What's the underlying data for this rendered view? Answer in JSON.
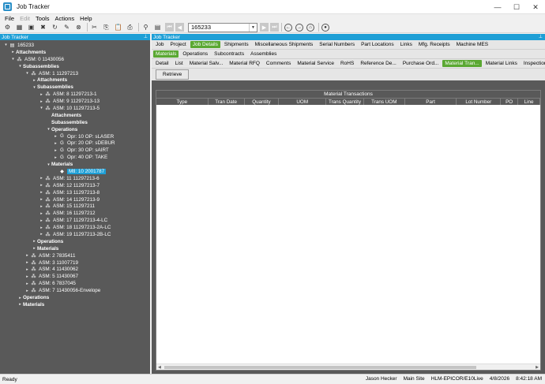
{
  "window": {
    "title": "Job Tracker"
  },
  "menu": [
    {
      "label": "File",
      "disabled": false
    },
    {
      "label": "Edit",
      "disabled": true
    },
    {
      "label": "Tools",
      "disabled": false
    },
    {
      "label": "Actions",
      "disabled": false
    },
    {
      "label": "Help",
      "disabled": false
    }
  ],
  "toolbar": {
    "job_value": "165233"
  },
  "left_panel": {
    "title": "Job Tracker"
  },
  "tree": [
    {
      "label": "165233",
      "level": 0,
      "toggle": "▾",
      "icon": "job-icon",
      "bold": false
    },
    {
      "label": "Attachments",
      "level": 1,
      "toggle": "▸",
      "icon": "",
      "bold": true
    },
    {
      "label": "ASM: 0 11430056",
      "level": 1,
      "toggle": "▾",
      "icon": "assembly-icon",
      "bold": false
    },
    {
      "label": "Subassemblies",
      "level": 2,
      "toggle": "▾",
      "icon": "",
      "bold": true
    },
    {
      "label": "ASM: 1 11297213",
      "level": 3,
      "toggle": "▾",
      "icon": "assembly-icon",
      "bold": false
    },
    {
      "label": "Attachments",
      "level": 4,
      "toggle": "▸",
      "icon": "",
      "bold": true
    },
    {
      "label": "Subassemblies",
      "level": 4,
      "toggle": "▾",
      "icon": "",
      "bold": true
    },
    {
      "label": "ASM: 8 11297213-1",
      "level": 5,
      "toggle": "▸",
      "icon": "assembly-icon",
      "bold": false
    },
    {
      "label": "ASM: 9 11297213-13",
      "level": 5,
      "toggle": "▸",
      "icon": "assembly-icon",
      "bold": false
    },
    {
      "label": "ASM: 10 11297213-5",
      "level": 5,
      "toggle": "▾",
      "icon": "assembly-icon",
      "bold": false
    },
    {
      "label": "Attachments",
      "level": 6,
      "toggle": "",
      "icon": "",
      "bold": true
    },
    {
      "label": "Subassemblies",
      "level": 6,
      "toggle": "",
      "icon": "",
      "bold": true
    },
    {
      "label": "Operations",
      "level": 6,
      "toggle": "▾",
      "icon": "",
      "bold": true
    },
    {
      "label": "Opr: 10 OP: sLASER",
      "level": 7,
      "toggle": "▸",
      "icon": "operation-icon",
      "bold": false
    },
    {
      "label": "Opr: 20 OP: sDEBUR",
      "level": 7,
      "toggle": "▸",
      "icon": "operation-icon",
      "bold": false
    },
    {
      "label": "Opr: 30 OP: sAIRT",
      "level": 7,
      "toggle": "▸",
      "icon": "operation-icon",
      "bold": false
    },
    {
      "label": "Opr: 40 OP: TAKE",
      "level": 7,
      "toggle": "▸",
      "icon": "operation-icon",
      "bold": false
    },
    {
      "label": "Materials",
      "level": 6,
      "toggle": "▾",
      "icon": "",
      "bold": true
    },
    {
      "label": "Mtl: 10 2001787",
      "level": 7,
      "toggle": "",
      "icon": "material-icon",
      "bold": false,
      "selected": true
    },
    {
      "label": "ASM: 11 11297213-6",
      "level": 5,
      "toggle": "▸",
      "icon": "assembly-icon",
      "bold": false
    },
    {
      "label": "ASM: 12 11297213-7",
      "level": 5,
      "toggle": "▸",
      "icon": "assembly-icon",
      "bold": false
    },
    {
      "label": "ASM: 13 11297213-8",
      "level": 5,
      "toggle": "▸",
      "icon": "assembly-icon",
      "bold": false
    },
    {
      "label": "ASM: 14 11297213-9",
      "level": 5,
      "toggle": "▸",
      "icon": "assembly-icon",
      "bold": false
    },
    {
      "label": "ASM: 15 11297211",
      "level": 5,
      "toggle": "▸",
      "icon": "assembly-icon",
      "bold": false
    },
    {
      "label": "ASM: 16 11297212",
      "level": 5,
      "toggle": "▸",
      "icon": "assembly-icon",
      "bold": false
    },
    {
      "label": "ASM: 17 11297213-4-LC",
      "level": 5,
      "toggle": "▸",
      "icon": "assembly-icon",
      "bold": false
    },
    {
      "label": "ASM: 18 11297213-2A-LC",
      "level": 5,
      "toggle": "▸",
      "icon": "assembly-icon",
      "bold": false
    },
    {
      "label": "ASM: 19 11297213-2B-LC",
      "level": 5,
      "toggle": "▸",
      "icon": "assembly-icon",
      "bold": false
    },
    {
      "label": "Operations",
      "level": 4,
      "toggle": "▸",
      "icon": "",
      "bold": true
    },
    {
      "label": "Materials",
      "level": 4,
      "toggle": "▸",
      "icon": "",
      "bold": true
    },
    {
      "label": "ASM: 2 7835411",
      "level": 3,
      "toggle": "▸",
      "icon": "assembly-icon",
      "bold": false
    },
    {
      "label": "ASM: 3 11007719",
      "level": 3,
      "toggle": "▸",
      "icon": "assembly-icon",
      "bold": false
    },
    {
      "label": "ASM: 4 11430062",
      "level": 3,
      "toggle": "▸",
      "icon": "assembly-icon",
      "bold": false
    },
    {
      "label": "ASM: 5 11430067",
      "level": 3,
      "toggle": "▸",
      "icon": "assembly-icon",
      "bold": false
    },
    {
      "label": "ASM: 6 7837045",
      "level": 3,
      "toggle": "▸",
      "icon": "assembly-icon",
      "bold": false
    },
    {
      "label": "ASM: 7 11430056-Envelope",
      "level": 3,
      "toggle": "▸",
      "icon": "assembly-icon",
      "bold": false
    },
    {
      "label": "Operations",
      "level": 2,
      "toggle": "▸",
      "icon": "",
      "bold": true
    },
    {
      "label": "Materials",
      "level": 2,
      "toggle": "▸",
      "icon": "",
      "bold": true
    }
  ],
  "right_panel": {
    "title": "Job Tracker"
  },
  "tabs_level1": [
    "Job",
    "Project",
    "Job Details",
    "Shipments",
    "Miscellaneous Shipments",
    "Serial Numbers",
    "Part Locations",
    "Links",
    "Mfg. Receipts",
    "Machine MES"
  ],
  "tabs_level1_active": 2,
  "tabs_level2": [
    "Materials",
    "Operations",
    "Subcontracts",
    "Assemblies"
  ],
  "tabs_level2_active": 0,
  "tabs_level3": [
    "Detail",
    "List",
    "Material Salv...",
    "Material RFQ",
    "Comments",
    "Material Service",
    "RoHS",
    "Reference De...",
    "Purchase Ord...",
    "Material Tran...",
    "Material Links",
    "Inspection"
  ],
  "tabs_level3_active": 9,
  "retrieve_label": "Retrieve",
  "grid": {
    "caption": "Material Transactions",
    "columns": [
      "Type",
      "Tran Date",
      "Quantity",
      "UOM",
      "Trans Quantity",
      "Trans UOM",
      "Part",
      "Lot Number",
      "PO",
      "Line"
    ]
  },
  "status": {
    "left": "Ready",
    "user": "Jason Hecker",
    "site": "Main Site",
    "environment": "HLM-EPICOR/E10Live",
    "date": "4/8/2026",
    "time": "8:42:18 AM"
  }
}
